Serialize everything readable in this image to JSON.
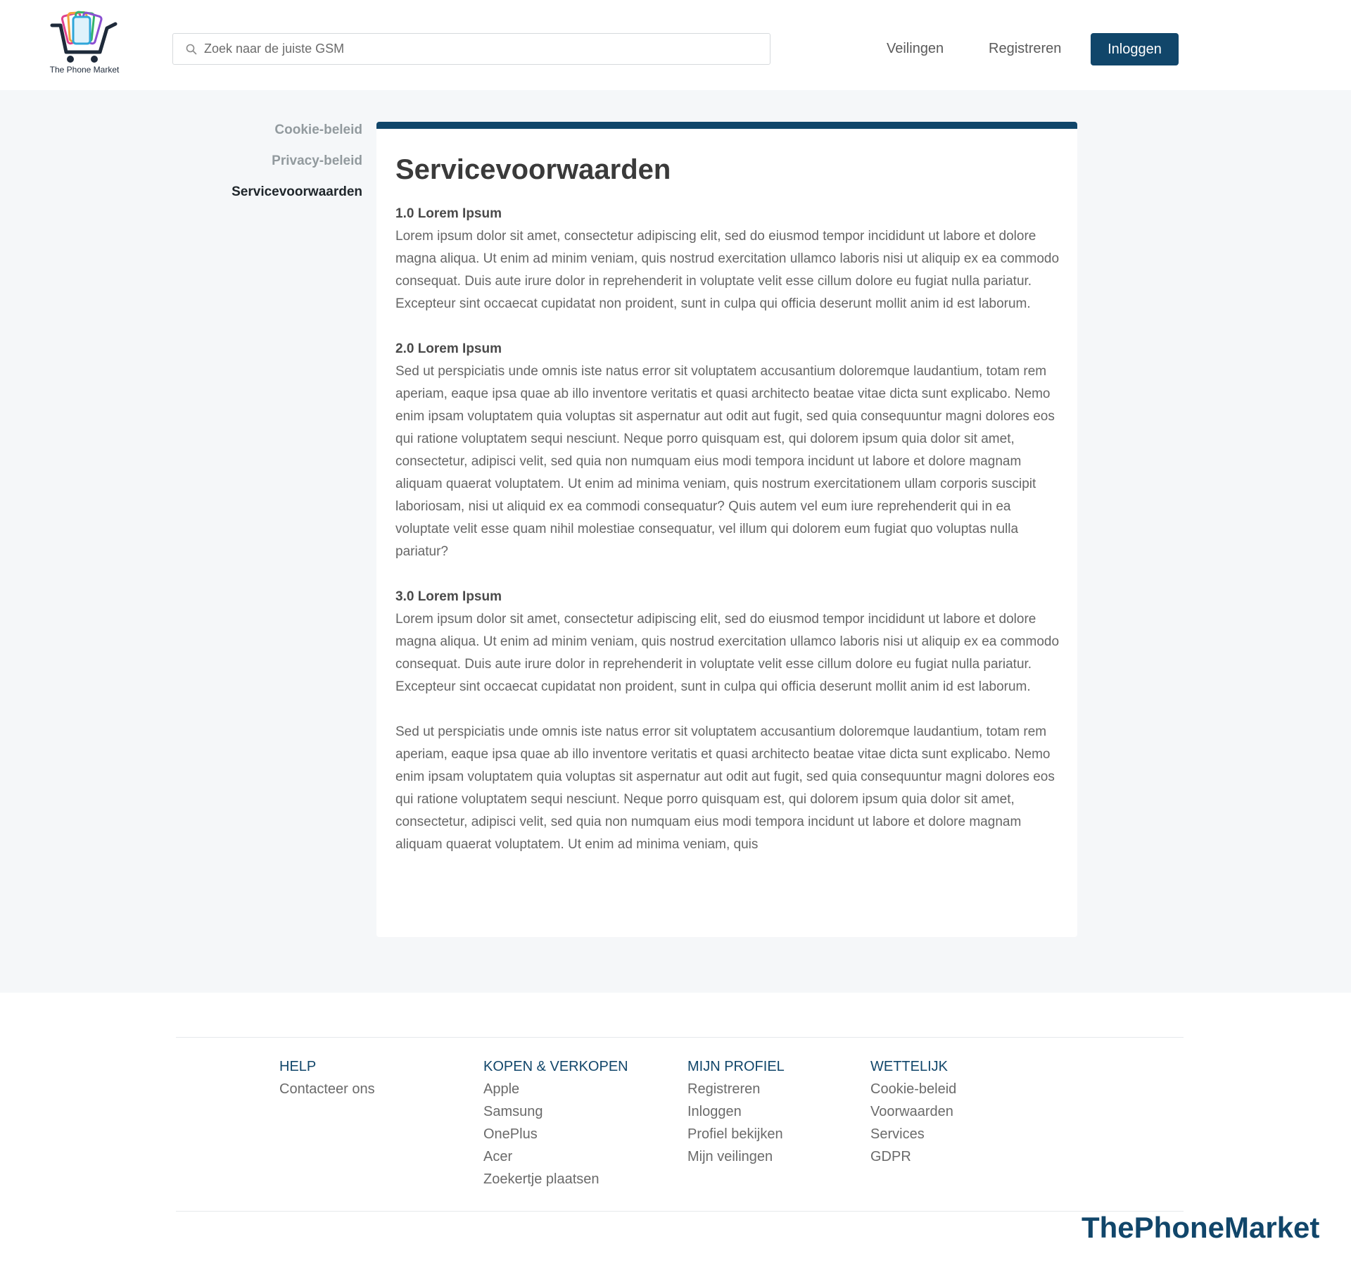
{
  "header": {
    "logo_text": "The Phone Market",
    "search_placeholder": "Zoek naar de juiste GSM",
    "nav": {
      "veilingen": "Veilingen",
      "registreren": "Registreren",
      "inloggen": "Inloggen"
    }
  },
  "sidebar": {
    "items": [
      {
        "label": "Cookie-beleid"
      },
      {
        "label": "Privacy-beleid"
      },
      {
        "label": "Servicevoorwaarden"
      }
    ]
  },
  "content": {
    "title": "Servicevoorwaarden",
    "sections": [
      {
        "heading": "1.0 Lorem Ipsum",
        "text": "Lorem ipsum dolor sit amet, consectetur adipiscing elit, sed do eiusmod tempor incididunt ut labore et dolore magna aliqua. Ut enim ad minim veniam, quis nostrud exercitation ullamco laboris nisi ut aliquip ex ea commodo consequat. Duis aute irure dolor in reprehenderit in voluptate velit esse cillum dolore eu fugiat nulla pariatur. Excepteur sint occaecat cupidatat non proident, sunt in culpa qui officia deserunt mollit anim id est laborum."
      },
      {
        "heading": "2.0 Lorem Ipsum",
        "text": "Sed ut perspiciatis unde omnis iste natus error sit voluptatem accusantium doloremque laudantium, totam rem aperiam, eaque ipsa quae ab illo inventore veritatis et quasi architecto beatae vitae dicta sunt explicabo. Nemo enim ipsam voluptatem quia voluptas sit aspernatur aut odit aut fugit, sed quia consequuntur magni dolores eos qui ratione voluptatem sequi nesciunt. Neque porro quisquam est, qui dolorem ipsum quia dolor sit amet, consectetur, adipisci velit, sed quia non numquam eius modi tempora incidunt ut labore et dolore magnam aliquam quaerat voluptatem. Ut enim ad minima veniam, quis nostrum exercitationem ullam corporis suscipit laboriosam, nisi ut aliquid ex ea commodi consequatur? Quis autem vel eum iure reprehenderit qui in ea voluptate velit esse quam nihil molestiae consequatur, vel illum qui dolorem eum fugiat quo voluptas nulla pariatur?"
      },
      {
        "heading": "3.0 Lorem Ipsum",
        "text": "Lorem ipsum dolor sit amet, consectetur adipiscing elit, sed do eiusmod tempor incididunt ut labore et dolore magna aliqua. Ut enim ad minim veniam, quis nostrud exercitation ullamco laboris nisi ut aliquip ex ea commodo consequat. Duis aute irure dolor in reprehenderit in voluptate velit esse cillum dolore eu fugiat nulla pariatur. Excepteur sint occaecat cupidatat non proident, sunt in culpa qui officia deserunt mollit anim id est laborum."
      }
    ],
    "extra_paragraph": "Sed ut perspiciatis unde omnis iste natus error sit voluptatem accusantium doloremque laudantium, totam rem aperiam, eaque ipsa quae ab illo inventore veritatis et quasi architecto beatae vitae dicta sunt explicabo. Nemo enim ipsam voluptatem quia voluptas sit aspernatur aut odit aut fugit, sed quia consequuntur magni dolores eos qui ratione voluptatem sequi nesciunt. Neque porro quisquam est, qui dolorem ipsum quia dolor sit amet, consectetur, adipisci velit, sed quia non numquam eius modi tempora incidunt ut labore et dolore magnam aliquam quaerat voluptatem. Ut enim ad minima veniam, quis"
  },
  "footer": {
    "help": {
      "heading": "HELP",
      "links": [
        "Contacteer ons"
      ]
    },
    "kopen": {
      "heading": "KOPEN & VERKOPEN",
      "links": [
        "Apple",
        "Samsung",
        "OnePlus",
        "Acer",
        "Zoekertje plaatsen"
      ]
    },
    "profiel": {
      "heading": "MIJN PROFIEL",
      "links": [
        "Registreren",
        "Inloggen",
        "Profiel bekijken",
        "Mijn veilingen"
      ]
    },
    "wettelijk": {
      "heading": "WETTELIJK",
      "links": [
        "Cookie-beleid",
        "Voorwaarden",
        "Services",
        "GDPR"
      ]
    },
    "brand": "ThePhoneMarket"
  },
  "colors": {
    "primary": "#11466a",
    "page_bg": "#f5f7f9",
    "text": "#666666",
    "sidebar_inactive": "#929a9e",
    "sidebar_active": "#1f262b"
  },
  "icons": {
    "logo": "phone-cart-logo-icon",
    "search": "search-icon"
  }
}
